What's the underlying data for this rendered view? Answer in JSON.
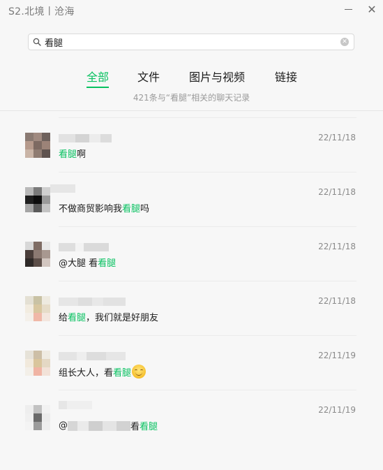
{
  "window": {
    "title": "S2.北境丨沧海",
    "minimize_icon": "minimize-icon",
    "close_icon": "close-icon",
    "close_glyph": "✕"
  },
  "search": {
    "value": "看腿",
    "icon": "search-icon",
    "clear_icon": "clear-icon",
    "clear_glyph": "✕"
  },
  "tabs": [
    {
      "label": "全部",
      "active": true
    },
    {
      "label": "文件",
      "active": false
    },
    {
      "label": "图片与视频",
      "active": false
    },
    {
      "label": "链接",
      "active": false
    }
  ],
  "summary": "421条与“看腿”相关的聊天记录",
  "colors": {
    "accent": "#07c160",
    "background": "#f7f7f7",
    "muted_text": "#9a9a9a"
  },
  "results": [
    {
      "date": "22/11/18",
      "pre": "",
      "highlight": "看腿",
      "post": "啊"
    },
    {
      "date": "22/11/18",
      "pre": "不做商贸影响我",
      "highlight": "看腿",
      "post": "吗"
    },
    {
      "date": "22/11/18",
      "pre": "@大腿 看",
      "highlight": "看腿",
      "post": ""
    },
    {
      "date": "22/11/18",
      "pre": "给",
      "highlight": "看腿",
      "post": "，我们就是好朋友"
    },
    {
      "date": "22/11/19",
      "pre": "组长大人，看",
      "highlight": "看腿",
      "post": "",
      "emoji": "smiling-face-emoji"
    },
    {
      "date": "22/11/19",
      "pre": "@",
      "mid": "看",
      "highlight": "看腿",
      "post": ""
    }
  ]
}
